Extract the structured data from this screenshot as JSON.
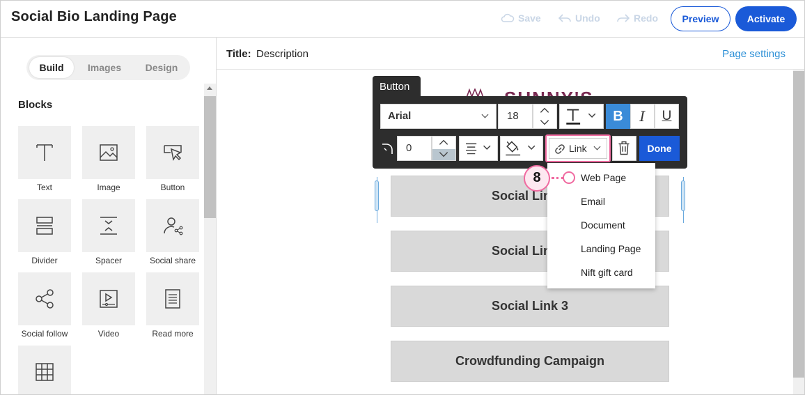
{
  "header": {
    "title": "Social Bio Landing Page",
    "save": "Save",
    "undo": "Undo",
    "redo": "Redo",
    "preview": "Preview",
    "activate": "Activate"
  },
  "sidebar": {
    "tabs": [
      "Build",
      "Images",
      "Design"
    ],
    "active_tab": "Build",
    "blocks_heading": "Blocks",
    "blocks": [
      {
        "label": "Text",
        "icon": "text-icon"
      },
      {
        "label": "Image",
        "icon": "image-icon"
      },
      {
        "label": "Button",
        "icon": "button-cursor-icon"
      },
      {
        "label": "Divider",
        "icon": "divider-icon"
      },
      {
        "label": "Spacer",
        "icon": "spacer-icon"
      },
      {
        "label": "Social share",
        "icon": "social-share-icon"
      },
      {
        "label": "Social follow",
        "icon": "share-nodes-icon"
      },
      {
        "label": "Video",
        "icon": "video-icon"
      },
      {
        "label": "Read more",
        "icon": "document-icon"
      },
      {
        "label": "",
        "icon": "table-grid-icon"
      }
    ]
  },
  "main": {
    "title_label": "Title:",
    "title_value": "Description",
    "page_settings": "Page settings",
    "logo_text": "SUNNY'S",
    "buttons": [
      "Social Link 1",
      "Social Link 2",
      "Social Link 3",
      "Crowdfunding Campaign"
    ]
  },
  "toolbar": {
    "tag": "Button",
    "font": "Arial",
    "font_size": "18",
    "corner_radius": "0",
    "link_label": "Link",
    "done": "Done"
  },
  "link_menu": {
    "items": [
      "Web Page",
      "Email",
      "Document",
      "Landing Page",
      "Nift gift card"
    ]
  },
  "callout": {
    "step": "8"
  },
  "colors": {
    "primary_blue": "#1a5ad8",
    "link_blue": "#2b8fd6",
    "callout_pink": "#f06aa0",
    "toolbar_dark": "#2d2d2d",
    "bold_active": "#3a8bd8"
  }
}
